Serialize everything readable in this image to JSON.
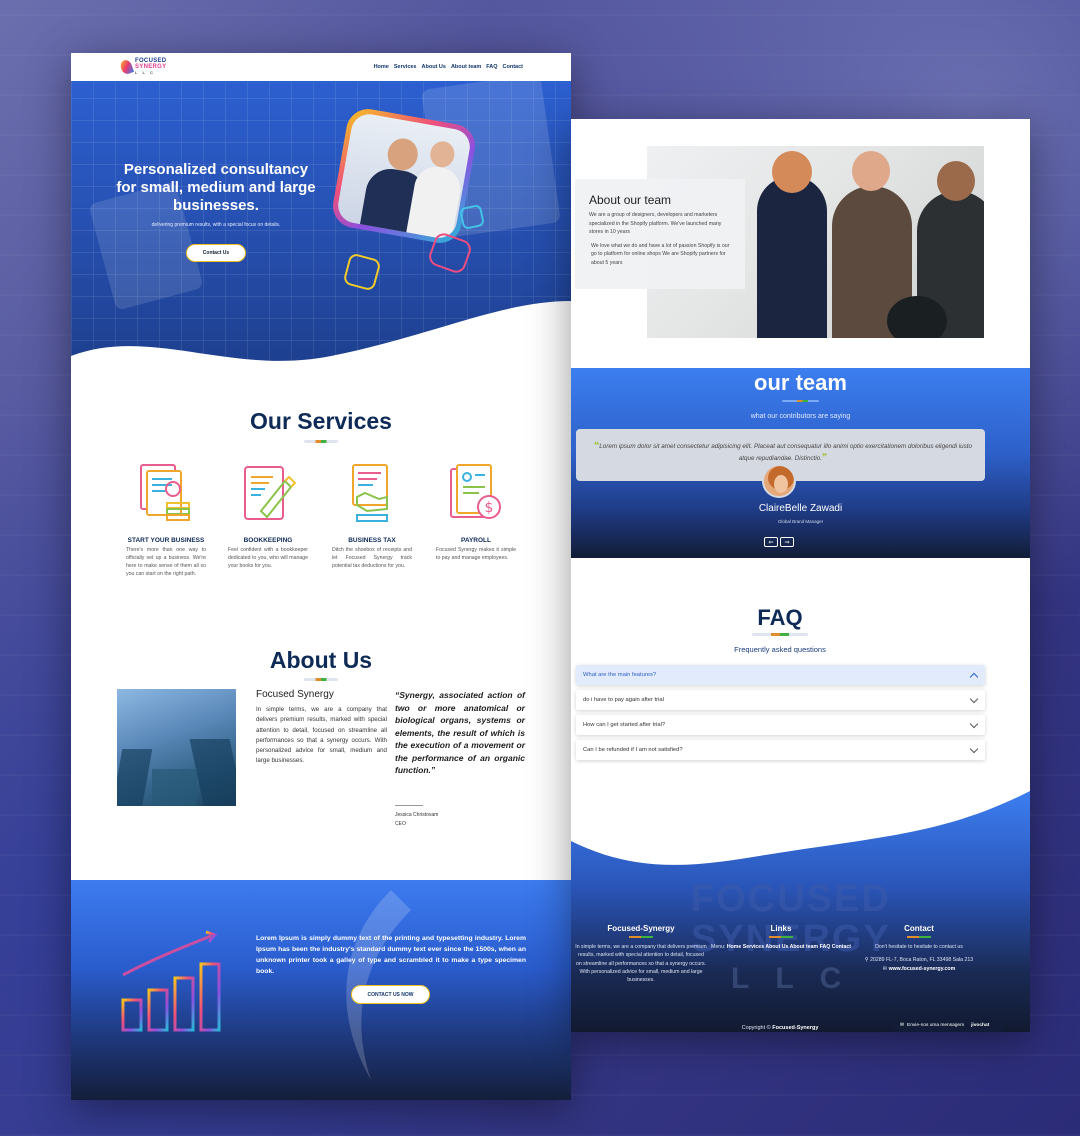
{
  "left_page": {
    "logo": {
      "line1": "FOCUSED",
      "line2": "SYNERGY",
      "line3": "L L C"
    },
    "nav": [
      "Home",
      "Services",
      "About Us",
      "About team",
      "FAQ",
      "Contact"
    ],
    "hero": {
      "title": "Personalized consultancy for small, medium and large businesses.",
      "subtitle": "delivering premium results, with a special focus on details.",
      "button": "Contact Us"
    },
    "services": {
      "title": "Our Services",
      "items": [
        {
          "name": "START YOUR BUSINESS",
          "desc": "There's more than one way to officially set up a business. We're here to make sense of them all so you can start on the right path."
        },
        {
          "name": "BOOKKEEPING",
          "desc": "Feel confident with a bookkeeper dedicated to you, who will manage your books for you."
        },
        {
          "name": "BUSINESS TAX",
          "desc": "Ditch the shoebox of receipts and let Focused Synergy track potential tax deductions for you."
        },
        {
          "name": "PAYROLL",
          "desc": "Focused Synergy makes it simple to pay and manage employees."
        }
      ]
    },
    "about": {
      "title": "About Us",
      "name": "Focused Synergy",
      "text": "In simple terms, we are a company that delivers premium results, marked with special attention to detail, focused on streamline all performances so that a synergy occurs. With personalized advice for small, medium and large businesses.",
      "quote": "“Synergy, associated action of two or more anatomical or biological organs, systems or elements, the result of which is the execution of a movement or the performance of an organic function.”",
      "author": "Jessica Christovam",
      "author_role": "CEO"
    },
    "cta": {
      "text": "Lorem Ipsum is simply dummy text of the printing and typesetting industry. Lorem Ipsum has been the industry's standard dummy text ever since the 1500s, when an unknown printer took a galley of type and scrambled it to make a type specimen book.",
      "button": "CONTACT US NOW"
    }
  },
  "right_page": {
    "about_team": {
      "title": "About our team",
      "p1": "We are a group of designers, developers and marketers specialized in the Shopify platform. We've launched many stores in 10 years",
      "p2": "We love what we do and have a lot of passion Shopify is our go to platform for online shops We are Shopify partners for about 5 years"
    },
    "team": {
      "title": "our team",
      "subtitle": "what our contributors are saying",
      "testimonial": "Lorem ipsum dolor sit amet consectetur adipisicing elit. Placeat aut consequatur illo animi optio exercitationem doloribus eligendi iusto atque repudiandae. Distinctio.",
      "name": "ClaireBelle Zawadi",
      "role": "Global Brand Manager",
      "prev": "⇐",
      "next": "⇒"
    },
    "faq": {
      "title": "FAQ",
      "subtitle": "Frequently asked questions",
      "items": [
        {
          "q": "What are the main features?",
          "active": true
        },
        {
          "q": "do i have to pay again after trial",
          "active": false
        },
        {
          "q": "How can I get started after trial?",
          "active": false
        },
        {
          "q": "Can I be refunded if I am not satisfied?",
          "active": false
        }
      ]
    },
    "footer": {
      "brand": "FOCUSED SYNERGY",
      "brand_llc": "LLC",
      "col1_title": "Focused-Synergy",
      "col1_text": "In simple terms, we are a company that delivers premium results, marked with special attention to detail, focused on streamline all performances so that a synergy occurs. With personalized advice for small, medium and large businesses.",
      "col2_title": "Links",
      "col2_prefix": "Menu:",
      "col2_links": "Home Services About Us About team FAQ Contact",
      "col3_title": "Contact",
      "col3_line1": "Don't hesitate to hesitate to contact us",
      "col3_line2": "20289 FL-7, Boca Raton, FL 33498 Sala 213",
      "col3_line3": "www.focused-synergy.com",
      "copyright_prefix": "Copyright ©",
      "copyright_brand": "Focused-Synergy",
      "chat_label": "Envie-nos uma mensagem",
      "chat_brand": "jivochat"
    }
  },
  "colors": {
    "navy": "#0e2a56",
    "blue": "#2d60c9",
    "accent_yellow": "#f2c21c",
    "accent_green": "#3fb13f"
  }
}
